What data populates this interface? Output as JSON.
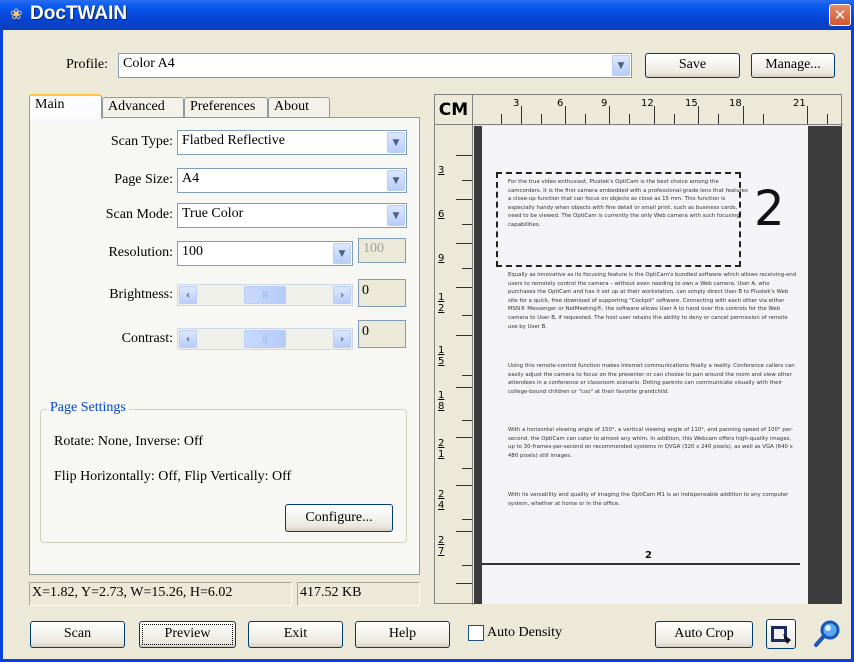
{
  "window": {
    "title": "DocTWAIN"
  },
  "profile": {
    "label": "Profile:",
    "value": "Color A4",
    "save_label": "Save",
    "manage_label": "Manage..."
  },
  "tabs": [
    {
      "label": "Main"
    },
    {
      "label": "Advanced"
    },
    {
      "label": "Preferences"
    },
    {
      "label": "About"
    }
  ],
  "main": {
    "scan_type": {
      "label": "Scan Type:",
      "value": "Flatbed Reflective"
    },
    "page_size": {
      "label": "Page Size:",
      "value": "A4"
    },
    "scan_mode": {
      "label": "Scan Mode:",
      "value": "True Color"
    },
    "resolution": {
      "label": "Resolution:",
      "value": "100",
      "custom": "100"
    },
    "brightness": {
      "label": "Brightness:",
      "value": "0"
    },
    "contrast": {
      "label": "Contrast:",
      "value": "0"
    }
  },
  "page_settings": {
    "title": "Page Settings",
    "rotate": "Rotate: None, Inverse: Off",
    "flip": "Flip Horizontally: Off, Flip Vertically: Off",
    "configure_label": "Configure..."
  },
  "status": {
    "coords": "X=1.82, Y=2.73, W=15.26, H=6.02",
    "size": "417.52 KB"
  },
  "ruler": {
    "unit": "CM",
    "top": [
      "3",
      "6",
      "9",
      "12",
      "15",
      "18",
      "21"
    ],
    "left": [
      "3",
      "6",
      "9",
      "12",
      "15",
      "18",
      "21",
      "24",
      "27"
    ]
  },
  "preview_doc": {
    "selected_text": "For the true video enthusiast, Plustek's OptiCam is the best choice among the camcorders. It is the first camera embedded with a professional-grade lens that features a close-up function that can focus on objects as close as 15 mm. This function is especially handy when objects with fine detail or small print, such as business cards, need to be viewed. The OptiCam is currently the only Web camera with such focusing capabilities.",
    "para1": "Equally as innovative as its focusing feature is the OptiCam's bundled software which allows receiving-end users to remotely control the camera – without even needing to own a Web camera. User A, who purchases the OptiCam and has it set up at their workstation, can simply direct User B to Plustek's Web site for a quick, free download of supporting \"Cockpit\" software. Connecting with each other via either MSN® Messenger or NetMeeting®, the software allows User A to hand over the controls for the Web camera to User B, if requested. The host user retains the ability to deny or cancel permission of remote use by User B.",
    "para2": "Using this remote-control function makes Internet communications finally a reality. Conference callers can easily adjust the camera to focus on the presenter or can choose to pan around the room and view other attendees in a conference or classroom scenario. Doting parents can communicate visually with their college-bound children or \"coo\" at their favorite grandchild.",
    "para3": "With a horizontal viewing angle of 150°, a vertical viewing angle of 110°, and panning speed of 100° per-second, the OptiCam can cater to almost any whim. In addition, this Webcam offers high-quality images, up to 30-frames-per-second on recommended systems in QVGA (320 x 240 pixels), as well as VGA (640 x 480 pixels) still images.",
    "para4": "With its versatility and quality of imaging the OptiCam M1 is an indispensable addition to any computer system, whether at home or in the office.",
    "big_number": "2",
    "page_number": "2"
  },
  "buttons": {
    "scan": "Scan",
    "preview": "Preview",
    "exit": "Exit",
    "help": "Help",
    "auto_density": "Auto Density",
    "auto_crop": "Auto Crop"
  }
}
